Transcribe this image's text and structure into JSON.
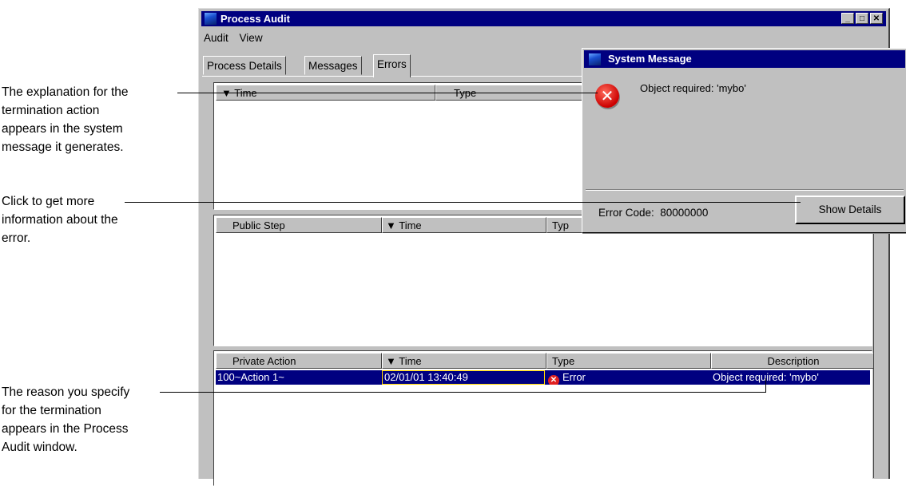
{
  "callouts": {
    "explanation": [
      "The explanation for the",
      "termination action",
      "appears in the system",
      "message it generates."
    ],
    "details": [
      "Click to get more",
      "information about the",
      "error."
    ],
    "reason": [
      "The reason you specify",
      "for the termination",
      "appears in the Process",
      "Audit window."
    ]
  },
  "window": {
    "title": "Process Audit",
    "buttons": {
      "minimize": "_",
      "maximize": "□",
      "close": "✕"
    }
  },
  "menu": [
    "Audit",
    "View"
  ],
  "tabs": [
    {
      "label": "Process Details"
    },
    {
      "label": "Messages"
    },
    {
      "label": "Errors",
      "active": true
    }
  ],
  "pane1": {
    "headers": [
      "▼ Time",
      "Type"
    ]
  },
  "pane2": {
    "headers": [
      "Public Step",
      "▼ Time",
      "Typ"
    ]
  },
  "pane3": {
    "headers": [
      "Private Action",
      "▼ Time",
      "Type",
      "Description"
    ],
    "rows": [
      {
        "action": "100~Action 1~",
        "time": "02/01/01 13:40:49",
        "type": "Error",
        "description": "Object required: 'mybo'"
      }
    ]
  },
  "dialog": {
    "title": "System Message",
    "message": "Object required: 'mybo'",
    "error_code": "Error Code:  80000000",
    "button": "Show Details",
    "icon": "error-icon"
  },
  "colors": {
    "titlebar": "#000080",
    "face": "#c0c0c0",
    "error": "#e02020",
    "selection": "#000080"
  }
}
